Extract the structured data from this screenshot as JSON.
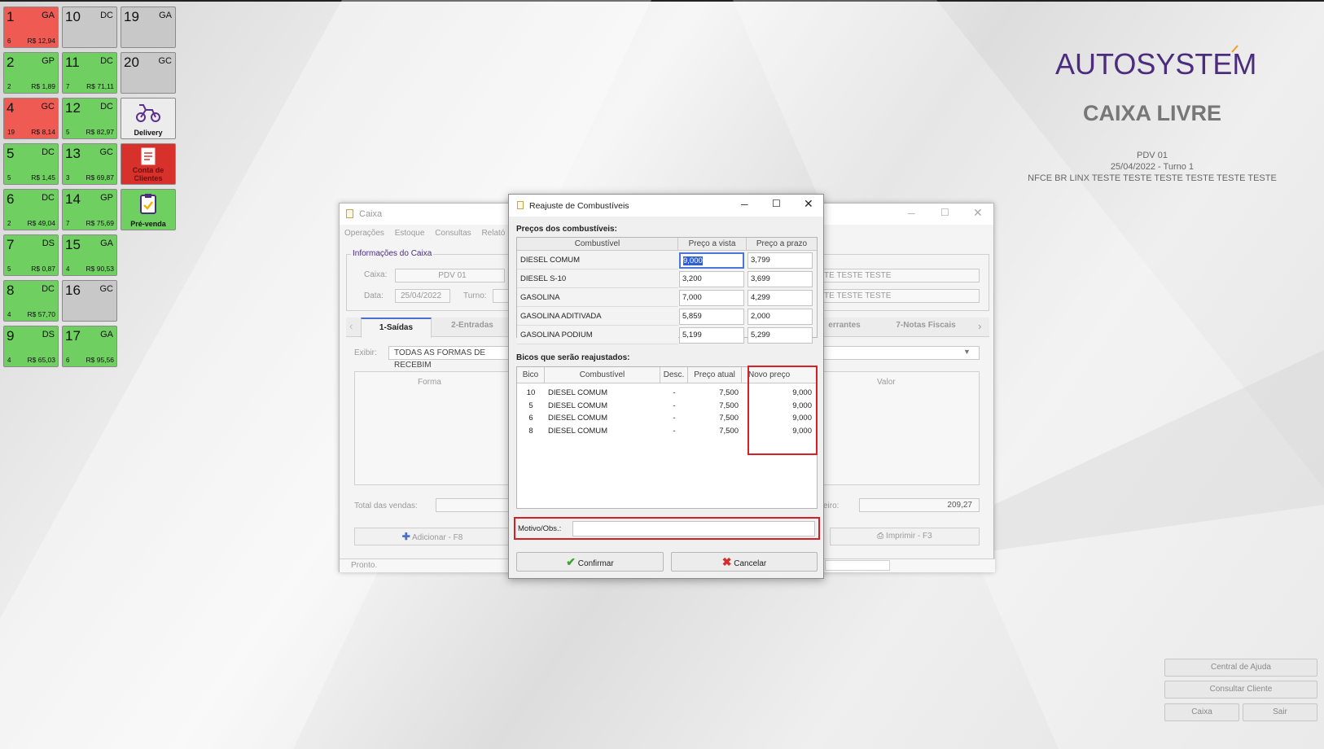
{
  "pumps": [
    {
      "num": "1",
      "code": "GA",
      "count": "6",
      "amount": "R$ 12,94",
      "status": "red"
    },
    {
      "num": "10",
      "code": "DC",
      "count": "",
      "amount": "",
      "status": "gray"
    },
    {
      "num": "19",
      "code": "GA",
      "count": "",
      "amount": "",
      "status": "gray"
    },
    {
      "num": "2",
      "code": "GP",
      "count": "2",
      "amount": "R$ 1,89",
      "status": "green"
    },
    {
      "num": "11",
      "code": "DC",
      "count": "7",
      "amount": "R$ 71,11",
      "status": "green"
    },
    {
      "num": "20",
      "code": "GC",
      "count": "",
      "amount": "",
      "status": "gray"
    },
    {
      "num": "4",
      "code": "GC",
      "count": "19",
      "amount": "R$ 8,14",
      "status": "red"
    },
    {
      "num": "12",
      "code": "DC",
      "count": "5",
      "amount": "R$ 82,97",
      "status": "green"
    },
    {
      "num": "5",
      "code": "DC",
      "count": "5",
      "amount": "R$ 1,45",
      "status": "green"
    },
    {
      "num": "13",
      "code": "GC",
      "count": "3",
      "amount": "R$ 69,87",
      "status": "green"
    },
    {
      "num": "6",
      "code": "DC",
      "count": "2",
      "amount": "R$ 49,04",
      "status": "green"
    },
    {
      "num": "14",
      "code": "GP",
      "count": "7",
      "amount": "R$ 75,69",
      "status": "green"
    },
    {
      "num": "7",
      "code": "DS",
      "count": "5",
      "amount": "R$ 0,87",
      "status": "green"
    },
    {
      "num": "15",
      "code": "GA",
      "count": "4",
      "amount": "R$ 90,53",
      "status": "green"
    },
    {
      "num": "8",
      "code": "DC",
      "count": "4",
      "amount": "R$ 57,70",
      "status": "green"
    },
    {
      "num": "16",
      "code": "GC",
      "count": "",
      "amount": "",
      "status": "gray"
    },
    {
      "num": "9",
      "code": "DS",
      "count": "4",
      "amount": "R$ 65,03",
      "status": "green"
    },
    {
      "num": "17",
      "code": "GA",
      "count": "6",
      "amount": "R$ 95,56",
      "status": "green"
    }
  ],
  "shortcuts": {
    "delivery": "Delivery",
    "conta": "Conta de Clientes",
    "prevenda": "Pré-venda"
  },
  "brand": {
    "logo": "AUTOSYSTEM",
    "status": "CAIXA LIVRE",
    "pdv": "PDV 01",
    "date_turn": "25/04/2022 - Turno 1",
    "company": "NFCE BR LINX TESTE TESTE TESTE TESTE TESTE TESTE"
  },
  "right_buttons": {
    "help": "Central de Ajuda",
    "customer": "Consultar Cliente",
    "caixa": "Caixa",
    "exit": "Sair"
  },
  "caixa_window": {
    "title": "Caixa",
    "menu": [
      "Operações",
      "Estoque",
      "Consultas",
      "Relató"
    ],
    "group": "Informações do Caixa",
    "caixa_label": "Caixa:",
    "caixa_value": "PDV 01",
    "data_label": "Data:",
    "data_value": "25/04/2022",
    "turno_label": "Turno:",
    "right_field1": "TE TESTE TESTE",
    "right_field2": "TE TESTE TESTE",
    "tabs": [
      "1-Saídas",
      "2-Entradas",
      "errantes",
      "7-Notas Fiscais"
    ],
    "exibir_label": "Exibir:",
    "exibir_value": "TODAS AS FORMAS DE RECEBIM",
    "col_forma": "Forma",
    "col_valor": "Valor",
    "total_label": "Total das vendas:",
    "dinheiro_label": "eiro:",
    "dinheiro_value": "209,27",
    "add_button": "Adicionar - F8",
    "print_button": "Imprimir - F3",
    "status": "Pronto."
  },
  "dialog": {
    "title": "Reajuste de Combustíveis",
    "prices_section": "Preços dos combustíveis:",
    "prices_headers": [
      "Combustível",
      "Preço a vista",
      "Preço a prazo"
    ],
    "prices": [
      {
        "fuel": "DIESEL COMUM",
        "vista": "9,000",
        "prazo": "3,799"
      },
      {
        "fuel": "DIESEL S-10",
        "vista": "3,200",
        "prazo": "3,699"
      },
      {
        "fuel": "GASOLINA",
        "vista": "7,000",
        "prazo": "4,299"
      },
      {
        "fuel": "GASOLINA ADITIVADA",
        "vista": "5,859",
        "prazo": "2,000"
      },
      {
        "fuel": "GASOLINA PODIUM",
        "vista": "5,199",
        "prazo": "5,299"
      }
    ],
    "bicos_section": "Bicos que serão reajustados:",
    "bicos_headers": [
      "Bico",
      "Combustível",
      "Desc.",
      "Preço atual",
      "Novo preço"
    ],
    "bicos": [
      {
        "bico": "10",
        "fuel": "DIESEL COMUM",
        "desc": "-",
        "atual": "7,500",
        "novo": "9,000"
      },
      {
        "bico": "5",
        "fuel": "DIESEL COMUM",
        "desc": "-",
        "atual": "7,500",
        "novo": "9,000"
      },
      {
        "bico": "6",
        "fuel": "DIESEL COMUM",
        "desc": "-",
        "atual": "7,500",
        "novo": "9,000"
      },
      {
        "bico": "8",
        "fuel": "DIESEL COMUM",
        "desc": "-",
        "atual": "7,500",
        "novo": "9,000"
      }
    ],
    "motivo_label": "Motivo/Obs.:",
    "confirm": "Confirmar",
    "cancel": "Cancelar"
  }
}
